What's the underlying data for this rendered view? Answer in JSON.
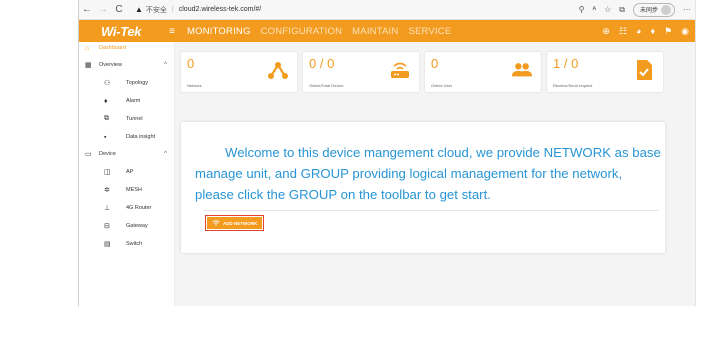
{
  "browser": {
    "back": "←",
    "forward": "→",
    "reload": "C",
    "security_label": "不安全",
    "url": "cloud2.wireless-tek.com/#/",
    "sync_label": "未同步",
    "more": "···"
  },
  "header": {
    "logo": "Wi-Tek",
    "menu_icon": "≡",
    "nav": [
      "MONITORING",
      "CONFIGURATION",
      "MAINTAIN",
      "SERVICE"
    ],
    "icons": [
      "⊕",
      "☷",
      "◕",
      "♦",
      "⚑",
      "◉"
    ]
  },
  "sidebar": {
    "items": [
      {
        "label": "Dashboard",
        "icon": "⌂"
      },
      {
        "label": "Overview",
        "icon": "▦"
      },
      {
        "label": "Topology",
        "icon": "⚇"
      },
      {
        "label": "Alarm",
        "icon": "♦"
      },
      {
        "label": "Tunnel",
        "icon": "⧉"
      },
      {
        "label": "Data insight",
        "icon": "▪"
      },
      {
        "label": "Device",
        "icon": "▭"
      },
      {
        "label": "AP",
        "icon": "◫"
      },
      {
        "label": "MESH",
        "icon": "✲"
      },
      {
        "label": "4G Router",
        "icon": "⊥"
      },
      {
        "label": "Gateway",
        "icon": "⊟"
      },
      {
        "label": "Switch",
        "icon": "▤"
      }
    ],
    "caret": "^"
  },
  "stats": [
    {
      "value": "0",
      "label": "Network"
    },
    {
      "value": "0 / 0",
      "label": "Online/Total Device"
    },
    {
      "value": "0",
      "label": "Online User"
    },
    {
      "value": "1 / 0",
      "label": "Receive/Send request"
    }
  ],
  "welcome": {
    "text": "Welcome to this device mangement cloud, we provide NETWORK as base manage unit, and GROUP providing logical management for the network, please click the GROUP on the toolbar to get start.",
    "button": "ADD NETWORK"
  },
  "colors": {
    "accent": "#f29b1f",
    "text_blue": "#2895d6",
    "border_red": "#e0452a"
  }
}
